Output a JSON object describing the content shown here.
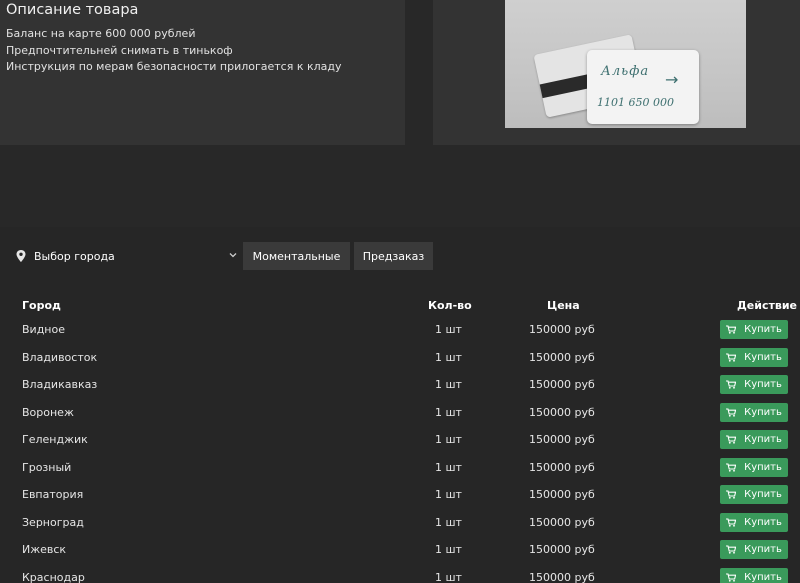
{
  "description": {
    "title": "Описание товара",
    "lines": [
      "Баланс на карте 600 000 рублей",
      "Предпочтительней снимать в тинькоф",
      "Инструкция по мерам безопасности прилогается к кладу"
    ]
  },
  "photo": {
    "handwriting_line1": "Альфа",
    "handwriting_line2": "1101 650 000"
  },
  "filters": {
    "city_select_label": "Выбор города",
    "pin_icon": "map-pin-icon",
    "chevron_icon": "chevron-down-icon",
    "instant_label": "Моментальные",
    "preorder_label": "Предзаказ"
  },
  "table": {
    "headers": {
      "city": "Город",
      "qty": "Кол-во",
      "price": "Цена",
      "action": "Действие"
    },
    "buy_label": "Купить",
    "buy_icon": "cart-icon",
    "buy_color": "#3a9a5b",
    "rows": [
      {
        "city": "Видное",
        "qty": "1 шт",
        "price": "150000 руб"
      },
      {
        "city": "Владивосток",
        "qty": "1 шт",
        "price": "150000 руб"
      },
      {
        "city": "Владикавказ",
        "qty": "1 шт",
        "price": "150000 руб"
      },
      {
        "city": "Воронеж",
        "qty": "1 шт",
        "price": "150000 руб"
      },
      {
        "city": "Геленджик",
        "qty": "1 шт",
        "price": "150000 руб"
      },
      {
        "city": "Грозный",
        "qty": "1 шт",
        "price": "150000 руб"
      },
      {
        "city": "Евпатория",
        "qty": "1 шт",
        "price": "150000 руб"
      },
      {
        "city": "Зерноград",
        "qty": "1 шт",
        "price": "150000 руб"
      },
      {
        "city": "Ижевск",
        "qty": "1 шт",
        "price": "150000 руб"
      },
      {
        "city": "Краснодар",
        "qty": "1 шт",
        "price": "150000 руб"
      }
    ]
  }
}
